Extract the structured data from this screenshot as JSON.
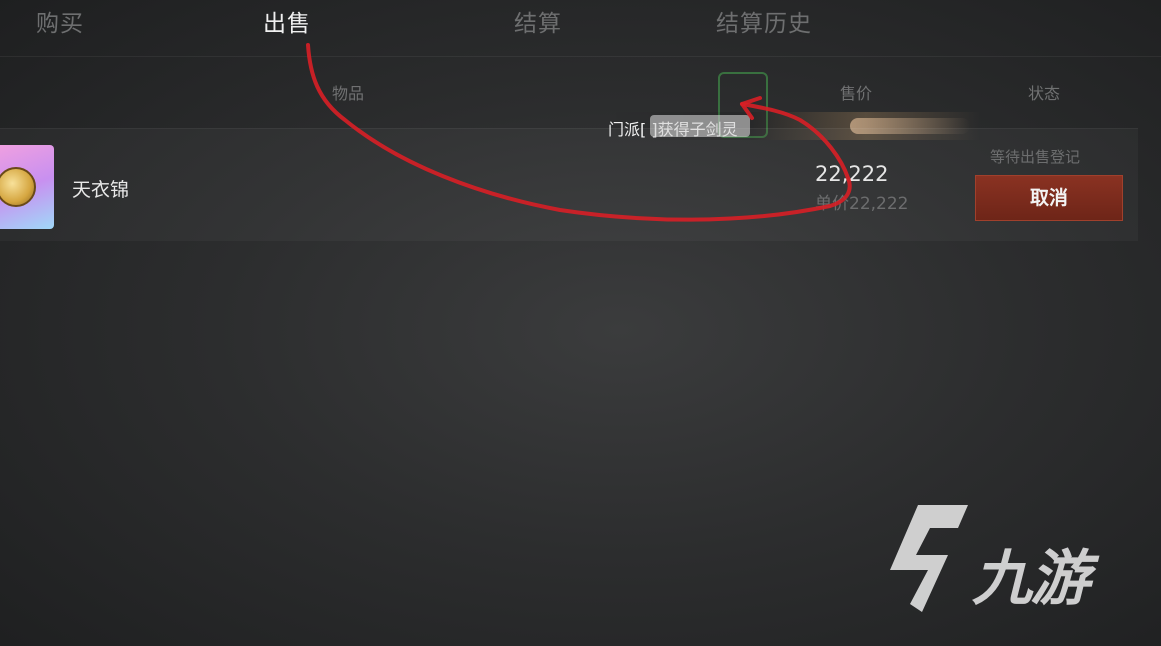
{
  "tabs": [
    {
      "label": "购买",
      "active": false
    },
    {
      "label": "出售",
      "active": true
    },
    {
      "label": "结算",
      "active": false
    },
    {
      "label": "结算历史",
      "active": false
    }
  ],
  "columns": {
    "item": "物品",
    "price": "售价",
    "status": "状态"
  },
  "notice": {
    "text": "门派[                ]获得子剑灵"
  },
  "listing": {
    "item_name": "天衣锦",
    "item_icon": "coin-icon",
    "price": "22,222",
    "unit_price": "单价22,222",
    "status": "等待出售登记",
    "cancel_label": "取消"
  },
  "watermark": {
    "text": "九游"
  },
  "colors": {
    "cancel_button": "#7a2b1e",
    "annotation": "#d81f26",
    "active_tab": "#f0f0f0",
    "inactive_tab": "#6e6f70"
  }
}
